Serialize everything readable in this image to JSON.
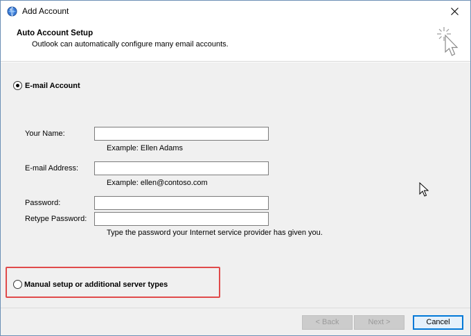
{
  "window": {
    "title": "Add Account"
  },
  "header": {
    "title": "Auto Account Setup",
    "subtitle": "Outlook can automatically configure many email accounts."
  },
  "options": {
    "email_account": {
      "label": "E-mail Account",
      "selected": true
    },
    "manual_setup": {
      "label": "Manual setup or additional server types",
      "selected": false
    }
  },
  "form": {
    "your_name": {
      "label": "Your Name:",
      "value": "",
      "hint": "Example: Ellen Adams"
    },
    "email": {
      "label": "E-mail Address:",
      "value": "",
      "hint": "Example: ellen@contoso.com"
    },
    "password": {
      "label": "Password:",
      "value": ""
    },
    "retype_password": {
      "label": "Retype Password:",
      "value": "",
      "hint": "Type the password your Internet service provider has given you."
    }
  },
  "footer": {
    "back_label": "< Back",
    "next_label": "Next >",
    "cancel_label": "Cancel"
  },
  "colors": {
    "highlight": "#e04a4a",
    "accent": "#0078d7",
    "panel": "#f0f0f0"
  }
}
